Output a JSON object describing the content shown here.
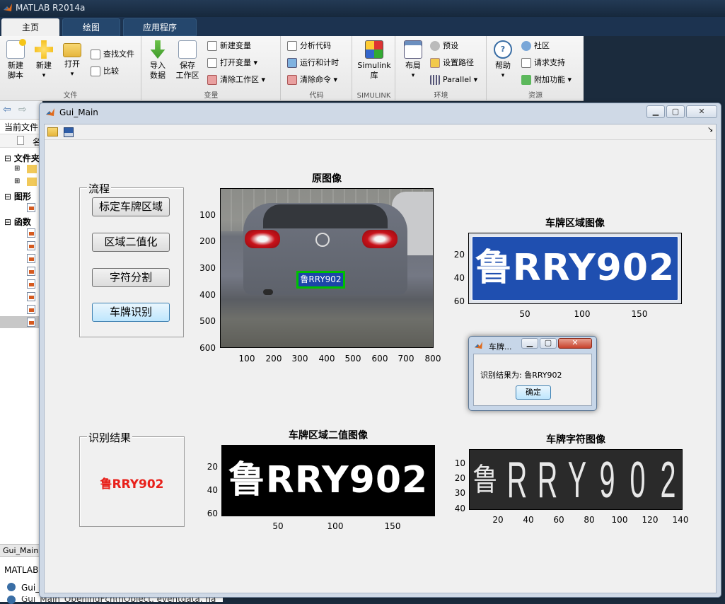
{
  "app": {
    "title": "MATLAB R2014a"
  },
  "ribbon": {
    "tabs": [
      "主页",
      "绘图",
      "应用程序"
    ],
    "groups": {
      "file": {
        "label": "文件",
        "new_script": "新建\n脚本",
        "new": "新建",
        "open": "打开",
        "find_files": "查找文件",
        "compare": "比较"
      },
      "variable": {
        "label": "变量",
        "import_data": "导入\n数据",
        "save_workspace": "保存\n工作区",
        "new_variable": "新建变量",
        "open_variable": "打开变量",
        "clear_workspace": "清除工作区"
      },
      "code": {
        "label": "代码",
        "analyze_code": "分析代码",
        "run_and_time": "运行和计时",
        "clear_commands": "清除命令"
      },
      "simulink": {
        "label": "SIMULINK",
        "library": "Simulink\n库"
      },
      "environment": {
        "label": "环境",
        "layout": "布局",
        "preferences": "预设",
        "set_path": "设置路径",
        "parallel": "Parallel"
      },
      "resources": {
        "label": "资源",
        "help": "帮助",
        "community": "社区",
        "request_support": "请求支持",
        "add_ons": "附加功能"
      }
    }
  },
  "left_panel": {
    "current_folder": "当前文件",
    "name_col": "名",
    "folder_section": "文件夹",
    "figure_section": "图形",
    "function_section": "函数",
    "bottom_tab": "Gui_Main",
    "matlab_label": "MATLAB",
    "file_item": "Gui_",
    "callback_line": "Gui_Main_OpeningFcn(hObject, eventdata, ha"
  },
  "gui": {
    "title": "Gui_Main",
    "process_panel": {
      "title": "流程",
      "buttons": [
        "标定车牌区域",
        "区域二值化",
        "字符分割",
        "车牌识别"
      ]
    },
    "result_panel": {
      "title": "识别结果",
      "text": "鲁RRY902"
    },
    "axes_original": {
      "title": "原图像",
      "y_ticks": [
        "100",
        "200",
        "300",
        "400",
        "500",
        "600"
      ],
      "x_ticks": [
        "100",
        "200",
        "300",
        "400",
        "500",
        "600",
        "700",
        "800"
      ],
      "plate_text": "鲁RRY902"
    },
    "axes_plate": {
      "title": "车牌区域图像",
      "y_ticks": [
        "20",
        "40",
        "60"
      ],
      "x_ticks": [
        "50",
        "100",
        "150"
      ],
      "plate_text": "鲁RRY902"
    },
    "axes_binary": {
      "title": "车牌区域二值图像",
      "y_ticks": [
        "20",
        "40",
        "60"
      ],
      "x_ticks": [
        "50",
        "100",
        "150"
      ],
      "plate_text": "鲁RRY902"
    },
    "axes_chars": {
      "title": "车牌字符图像",
      "y_ticks": [
        "10",
        "20",
        "30",
        "40"
      ],
      "x_ticks": [
        "20",
        "40",
        "60",
        "80",
        "100",
        "120",
        "140"
      ],
      "chars": [
        "鲁",
        "R",
        "R",
        "Y",
        "9",
        "0",
        "2"
      ]
    }
  },
  "dialog": {
    "title": "车牌...",
    "message": "识别结果为: 鲁RRY902",
    "ok": "确定"
  },
  "colors": {
    "result_red": "#e8201a",
    "plate_blue": "#1f4fb0",
    "detect_green": "#00c000"
  }
}
